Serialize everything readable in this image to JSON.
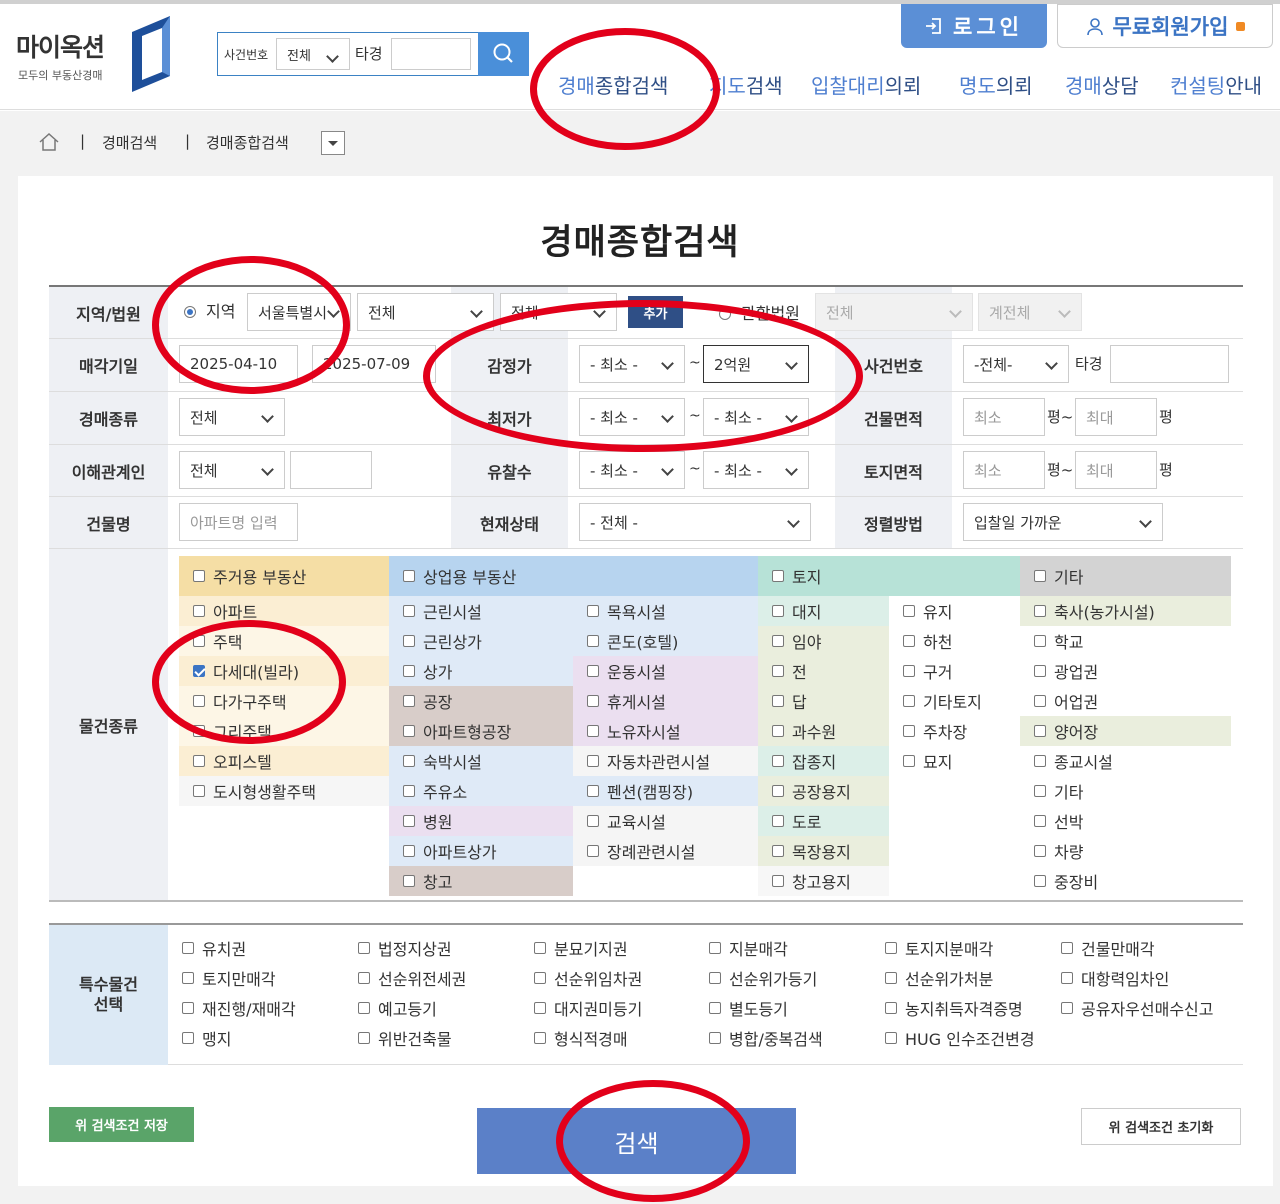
{
  "header": {
    "logo_title": "마이옥션",
    "logo_sub": "모두의 부동산경매",
    "search": {
      "label": "사건번호",
      "select": "전체",
      "prefix": "타경",
      "value": ""
    },
    "login": "로그인",
    "join": "무료회원가입",
    "nav": [
      {
        "a": "경매",
        "b": "종합검색"
      },
      {
        "a": "지도",
        "b": "검색"
      },
      {
        "a": "입찰대리",
        "b": "의뢰"
      },
      {
        "a": "명도",
        "b": "의뢰"
      },
      {
        "a": "경매",
        "b": "상담"
      },
      {
        "a": "컨설팅",
        "b": "안내"
      }
    ]
  },
  "breadcrumb": {
    "sep": "|",
    "items": [
      "경매검색",
      "경매종합검색"
    ]
  },
  "page_title": "경매종합검색",
  "form": {
    "region_label": "지역/법원",
    "region_radio": "지역",
    "region_sido": "서울특별시",
    "region_gugun": "전체",
    "region_dong": "전체",
    "add": "추가",
    "court_radio": "관할법원",
    "court_select": "전체",
    "court_sub": "계전체",
    "date_label": "매각기일",
    "date_from": "2025-04-10",
    "date_to": "2025-07-09",
    "appraisal_label": "감정가",
    "appraisal_min": "- 최소 -",
    "appraisal_max": "2억원",
    "case_label": "사건번호",
    "case_select": "-전체-",
    "case_prefix": "타경",
    "kind_label": "경매종류",
    "kind_value": "전체",
    "minprice_label": "최저가",
    "minprice_min": "- 최소 -",
    "minprice_max": "- 최소 -",
    "building_area_label": "건물면적",
    "min_ph": "최소",
    "max_ph": "최대",
    "pyeong": "평",
    "pyeong_tilde": "평~",
    "tilde": "~",
    "interest_label": "이해관계인",
    "interest_value": "전체",
    "fail_label": "유찰수",
    "fail_min": "- 최소 -",
    "fail_max": "- 최소 -",
    "land_area_label": "토지면적",
    "bname_label": "건물명",
    "bname_ph": "아파트명 입력",
    "status_label": "현재상태",
    "status_value": "- 전체 -",
    "sort_label": "정렬방법",
    "sort_value": "입찰일 가까운",
    "type_label": "물건종류"
  },
  "property_types": {
    "residential": {
      "title": "주거용 부동산",
      "items": [
        "아파트",
        "주택",
        "다세대(빌라)",
        "다가구주택",
        "그리주택",
        "오피스텔",
        "도시형생활주택"
      ],
      "checked": "다세대(빌라)"
    },
    "commercial": {
      "title": "상업용 부동산",
      "col1": [
        "근린시설",
        "근린상가",
        "상가",
        "공장",
        "아파트형공장",
        "숙박시설",
        "주유소",
        "병원",
        "아파트상가",
        "창고"
      ],
      "col2": [
        "목욕시설",
        "콘도(호텔)",
        "운동시설",
        "휴게시설",
        "노유자시설",
        "자동차관련시설",
        "펜션(캠핑장)",
        "교육시설",
        "장례관련시설"
      ]
    },
    "land": {
      "title": "토지",
      "col1": [
        "대지",
        "임야",
        "전",
        "답",
        "과수원",
        "잡종지",
        "공장용지",
        "도로",
        "목장용지",
        "창고용지"
      ],
      "col2": [
        "유지",
        "하천",
        "구거",
        "기타토지",
        "주차장",
        "묘지"
      ]
    },
    "etc": {
      "title": "기타",
      "items": [
        "축사(농가시설)",
        "학교",
        "광업권",
        "어업권",
        "양어장",
        "종교시설",
        "기타",
        "선박",
        "차량",
        "중장비"
      ]
    }
  },
  "special": {
    "label_1": "특수물건",
    "label_2": "선택",
    "rows": [
      [
        "유치권",
        "법정지상권",
        "분묘기지권",
        "지분매각",
        "토지지분매각",
        "건물만매각"
      ],
      [
        "토지만매각",
        "선순위전세권",
        "선순위임차권",
        "선순위가등기",
        "선순위가처분",
        "대항력임차인"
      ],
      [
        "재진행/재매각",
        "예고등기",
        "대지권미등기",
        "별도등기",
        "농지취득자격증명",
        "공유자우선매수신고"
      ],
      [
        "맹지",
        "위반건축물",
        "형식적경매",
        "병합/중복검색",
        "HUG 인수조건변경"
      ]
    ]
  },
  "buttons": {
    "save": "위 검색조건 저장",
    "search": "검색",
    "reset": "위 검색조건 초기화"
  },
  "colors": {
    "accent": "#4a8fd9",
    "annotation": "#e2001a",
    "residential": "#f5dea5",
    "commercial": "#b7d4ef",
    "land": "#b7e2d7",
    "etc": "#d3d3d3"
  }
}
